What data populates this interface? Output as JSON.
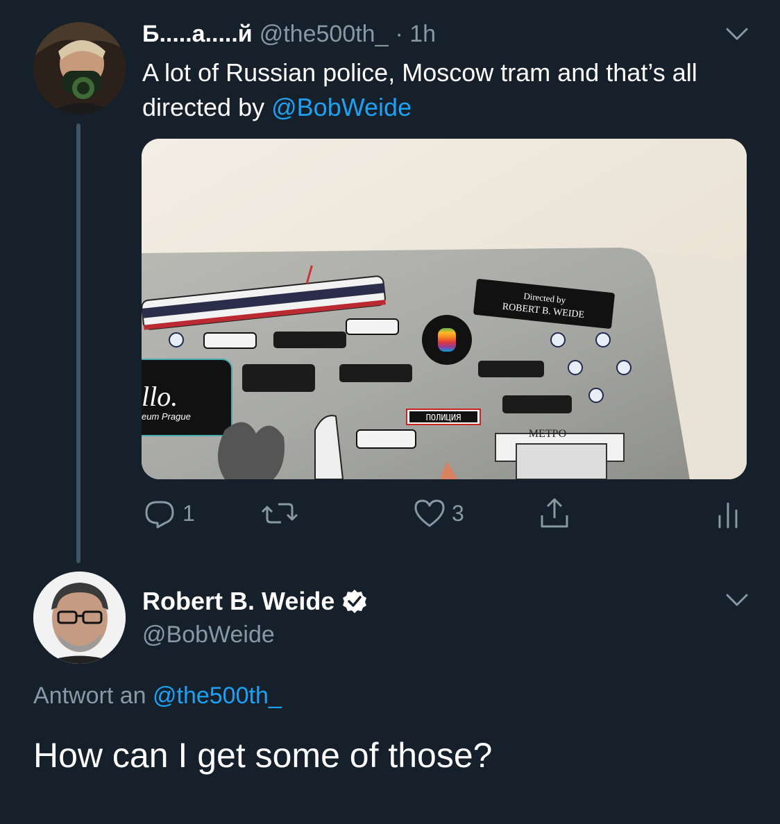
{
  "tweet1": {
    "display_name": "Б.....а.....й",
    "handle": "@the500th_",
    "time": "· 1h",
    "text_before": "A lot of Russian police, Moscow tram and that’s all directed by ",
    "mention": "@BobWeide",
    "media": {
      "sticker_directed_line1": "Directed by",
      "sticker_directed_line2": "ROBERT B. WEIDE",
      "sticker_police": "ПОЛИЦИЯ",
      "sticker_metro": "МЕТРО",
      "sticker_trello": "llo.",
      "sticker_prague": "eum Prague"
    },
    "actions": {
      "reply_count": "1",
      "like_count": "3"
    }
  },
  "tweet2": {
    "display_name": "Robert B. Weide",
    "handle": "@BobWeide",
    "reply_prefix": "Antwort an ",
    "reply_mention": "@the500th_",
    "text": "How can I get some of those?"
  },
  "colors": {
    "background": "#15202b",
    "secondary_text": "#8899a6",
    "link": "#1da1f2",
    "thread_line": "#3d5466"
  },
  "icons": [
    "chevron-down-icon",
    "reply-icon",
    "retweet-icon",
    "like-icon",
    "share-icon",
    "stats-icon",
    "verified-badge-icon"
  ]
}
